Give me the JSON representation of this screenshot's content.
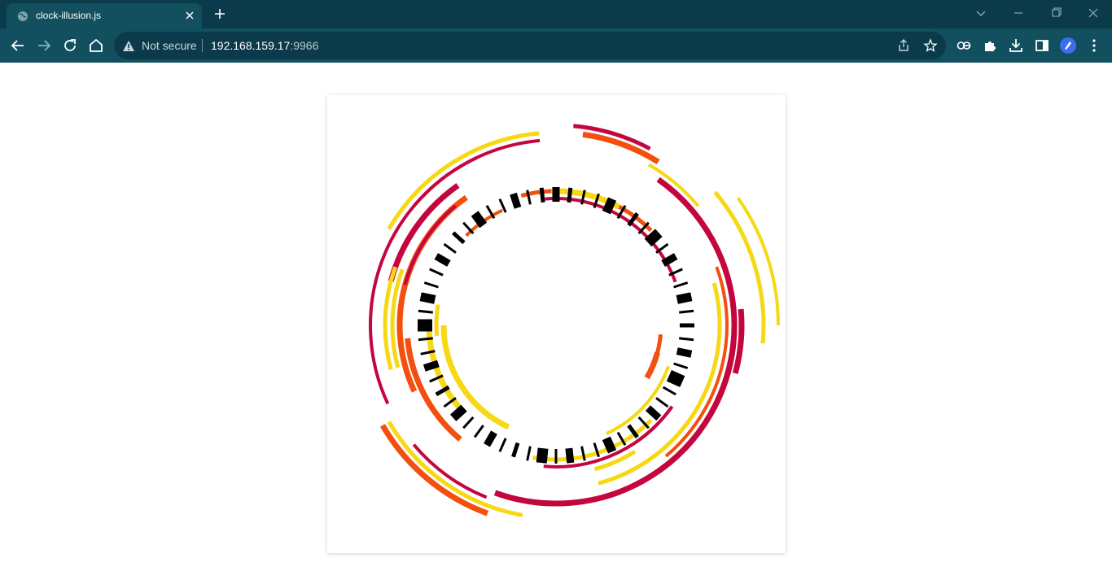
{
  "tab": {
    "title": "clock-illusion.js",
    "favicon": "globe-icon"
  },
  "toolbar": {
    "security_label": "Not secure",
    "url_host": "192.168.159.17",
    "url_port": ":9966"
  },
  "icons": [
    "back-icon",
    "forward-icon",
    "reload-icon",
    "home-icon",
    "warning-icon",
    "share-icon",
    "star-icon",
    "extension-ae-icon",
    "puzzle-icon",
    "download-icon",
    "sidebar-icon",
    "profile-avatar-icon",
    "more-icon"
  ],
  "colors": {
    "crimson": "#c4063f",
    "orange": "#f34f0f",
    "yellow": "#f6d814",
    "black": "#000000",
    "tab_bar": "#0b3b4a",
    "toolbar": "#12505f"
  },
  "illusion": {
    "tick_count": 60,
    "tick_widths": [
      9,
      5,
      3,
      3,
      11,
      3,
      5,
      3,
      13,
      3,
      9,
      3,
      3,
      11,
      3,
      5,
      3,
      9,
      3,
      15,
      3,
      3,
      9,
      3,
      5,
      3,
      11,
      3,
      3,
      9,
      3,
      13,
      3,
      5,
      3,
      9,
      3,
      3,
      11,
      3,
      5,
      3,
      9,
      3,
      3,
      15,
      3,
      11,
      3,
      3,
      9,
      3,
      5,
      3,
      11,
      3,
      3,
      9,
      3,
      5
    ],
    "arcs": [
      {
        "color": "crimson",
        "start": -85,
        "end": -62,
        "ring": 9
      },
      {
        "color": "orange",
        "start": -82,
        "end": -58,
        "ring": 8
      },
      {
        "color": "crimson",
        "start": -140,
        "end": -95,
        "ring": 7
      },
      {
        "color": "yellow",
        "start": -150,
        "end": -95,
        "ring": 8
      },
      {
        "color": "crimson",
        "start": -55,
        "end": 25,
        "ring": 6
      },
      {
        "color": "yellow",
        "start": -60,
        "end": -40,
        "ring": 7
      },
      {
        "color": "yellow",
        "start": -40,
        "end": 5,
        "ring": 10
      },
      {
        "color": "crimson",
        "start": 5,
        "end": 110,
        "ring": 6
      },
      {
        "color": "orange",
        "start": -20,
        "end": 50,
        "ring": 5
      },
      {
        "color": "yellow",
        "start": -15,
        "end": 75,
        "ring": 4
      },
      {
        "color": "crimson",
        "start": -165,
        "end": -125,
        "ring": 5
      },
      {
        "color": "crimson",
        "start": 155,
        "end": 245,
        "ring": 7
      },
      {
        "color": "yellow",
        "start": 100,
        "end": 150,
        "ring": 8
      },
      {
        "color": "orange",
        "start": 110,
        "end": 150,
        "ring": 9
      },
      {
        "color": "crimson",
        "start": 112,
        "end": 140,
        "ring": 7
      },
      {
        "color": "yellow",
        "start": 165,
        "end": 200,
        "ring": 5
      },
      {
        "color": "orange",
        "start": 155,
        "end": 235,
        "ring": 3
      },
      {
        "color": "crimson",
        "start": 195,
        "end": 230,
        "ring": 3
      },
      {
        "color": "yellow",
        "start": 165,
        "end": 200,
        "ring": 4
      },
      {
        "color": "orange",
        "start": 130,
        "end": 175,
        "ring": 2
      },
      {
        "color": "crimson",
        "start": 35,
        "end": 95,
        "ring": 1
      },
      {
        "color": "yellow",
        "start": 45,
        "end": 100,
        "ring": 0
      },
      {
        "color": "yellow",
        "start": 140,
        "end": 180,
        "ring": -1
      },
      {
        "color": "crimson",
        "start": -95,
        "end": -20,
        "ring": -1
      },
      {
        "color": "orange",
        "start": -105,
        "end": -45,
        "ring": 0
      },
      {
        "color": "yellow",
        "start": -92,
        "end": -62,
        "ring": 0
      },
      {
        "color": "orange",
        "start": -135,
        "end": -115,
        "ring": -1
      },
      {
        "color": "yellow",
        "start": 175,
        "end": 190,
        "ring": -2
      },
      {
        "color": "yellow",
        "start": 115,
        "end": 180,
        "ring": -3
      },
      {
        "color": "yellow",
        "start": 20,
        "end": 65,
        "ring": -2
      },
      {
        "color": "orange",
        "start": 5,
        "end": 18,
        "ring": -4
      },
      {
        "color": "orange",
        "start": 15,
        "end": 30,
        "ring": -4
      },
      {
        "color": "crimson",
        "start": 35,
        "end": 55,
        "ring": 1
      },
      {
        "color": "yellow",
        "start": 58,
        "end": 75,
        "ring": 2
      },
      {
        "color": "crimson",
        "start": -5,
        "end": 15,
        "ring": 7
      },
      {
        "color": "yellow",
        "start": -35,
        "end": 0,
        "ring": 12
      }
    ]
  }
}
